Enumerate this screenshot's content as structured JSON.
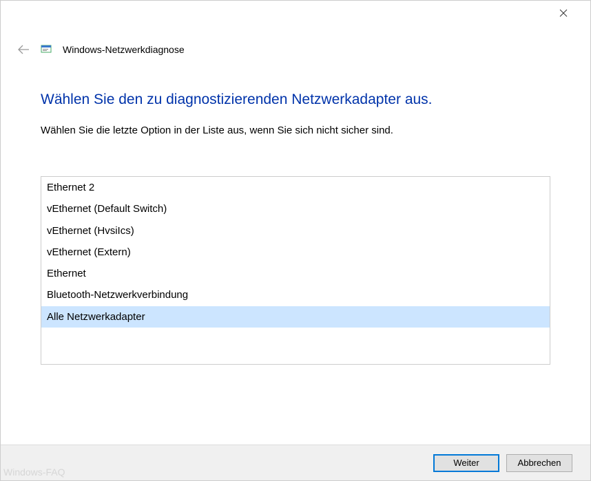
{
  "window": {
    "wizard_title": "Windows-Netzwerkdiagnose"
  },
  "main": {
    "heading": "Wählen Sie den zu diagnostizierenden Netzwerkadapter aus.",
    "instruction": "Wählen Sie die letzte Option in der Liste aus, wenn Sie sich nicht sicher sind."
  },
  "adapters": {
    "items": [
      {
        "label": "Ethernet 2",
        "selected": false
      },
      {
        "label": "vEthernet (Default Switch)",
        "selected": false
      },
      {
        "label": "vEthernet (HvsiIcs)",
        "selected": false
      },
      {
        "label": "vEthernet (Extern)",
        "selected": false
      },
      {
        "label": "Ethernet",
        "selected": false
      },
      {
        "label": "Bluetooth-Netzwerkverbindung",
        "selected": false
      },
      {
        "label": "Alle Netzwerkadapter",
        "selected": true
      }
    ]
  },
  "footer": {
    "next_label": "Weiter",
    "cancel_label": "Abbrechen"
  },
  "watermark": "Windows-FAQ"
}
